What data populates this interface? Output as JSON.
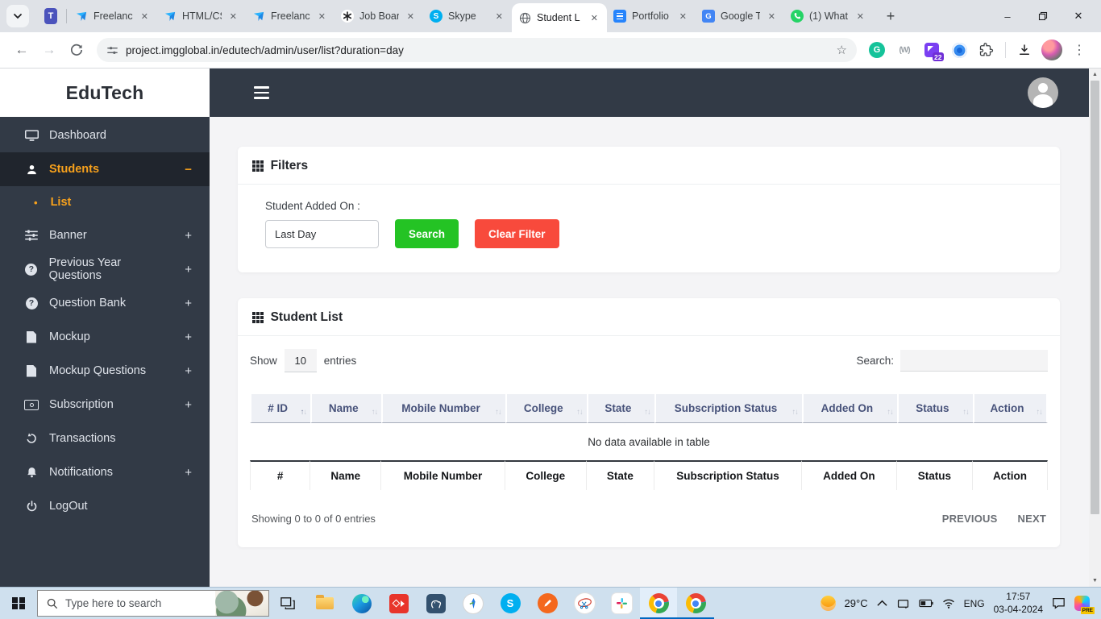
{
  "browser": {
    "tabs": [
      {
        "label": "Freelance"
      },
      {
        "label": "HTML/CS"
      },
      {
        "label": "Freelance"
      },
      {
        "label": "Job Boar"
      },
      {
        "label": "Skype"
      },
      {
        "label": "Student L",
        "active": true
      },
      {
        "label": "Portfolio"
      },
      {
        "label": "Google T"
      },
      {
        "label": "(1) What"
      }
    ],
    "url": "project.imgglobal.in/edutech/admin/user/list?duration=day",
    "extension_badge": "22"
  },
  "icons": {
    "close": "✕",
    "plus": "+",
    "minimize": "–",
    "overflow_menu": "⋮",
    "star": "☆",
    "back": "←",
    "forward": "→",
    "sort_up": "↑",
    "sort_down": "↓",
    "bullet": "•",
    "question_mark": "?",
    "scroll_up": "▲",
    "scroll_down": "▼",
    "teams_letter": "T",
    "skype_letter": "S",
    "grammarly_letter": "G",
    "translate_letter": "G",
    "w_ext": "(W)"
  },
  "sidebar": {
    "brand": "EduTech",
    "items": [
      {
        "label": "Dashboard"
      },
      {
        "label": "Students",
        "toggle": "−",
        "active": true
      },
      {
        "label": "List",
        "sub": true,
        "active": true
      },
      {
        "label": "Banner",
        "toggle": "+"
      },
      {
        "label": "Previous Year Questions",
        "toggle": "+"
      },
      {
        "label": "Question Bank",
        "toggle": "+"
      },
      {
        "label": "Mockup",
        "toggle": "+"
      },
      {
        "label": "Mockup Questions",
        "toggle": "+"
      },
      {
        "label": "Subscription",
        "toggle": "+"
      },
      {
        "label": "Transactions"
      },
      {
        "label": "Notifications",
        "toggle": "+"
      },
      {
        "label": "LogOut"
      }
    ]
  },
  "filters": {
    "title": "Filters",
    "field_label": "Student Added On :",
    "field_value": "Last Day",
    "search_button": "Search",
    "clear_button": "Clear Filter"
  },
  "student_list": {
    "title": "Student List",
    "show_label": "Show",
    "entries_value": "10",
    "entries_label": "entries",
    "search_label": "Search:",
    "columns": [
      "# ID",
      "Name",
      "Mobile Number",
      "College",
      "State",
      "Subscription Status",
      "Added On",
      "Status",
      "Action"
    ],
    "footer_columns": [
      "#",
      "Name",
      "Mobile Number",
      "College",
      "State",
      "Subscription Status",
      "Added On",
      "Status",
      "Action"
    ],
    "empty_message": "No data available in table",
    "info": "Showing 0 to 0 of 0 entries",
    "prev_label": "PREVIOUS",
    "next_label": "NEXT"
  },
  "taskbar": {
    "search_placeholder": "Type here to search",
    "temperature": "29°C",
    "language": "ENG",
    "time": "17:57",
    "date": "03-04-2024",
    "copilot_badge": "PRE"
  },
  "colors": {
    "accent_orange": "#f7a11c",
    "sidebar_bg": "#323a46",
    "search_green": "#24c324",
    "clear_red": "#f84a3c",
    "taskbar_open_indicator": "#0067c0"
  }
}
